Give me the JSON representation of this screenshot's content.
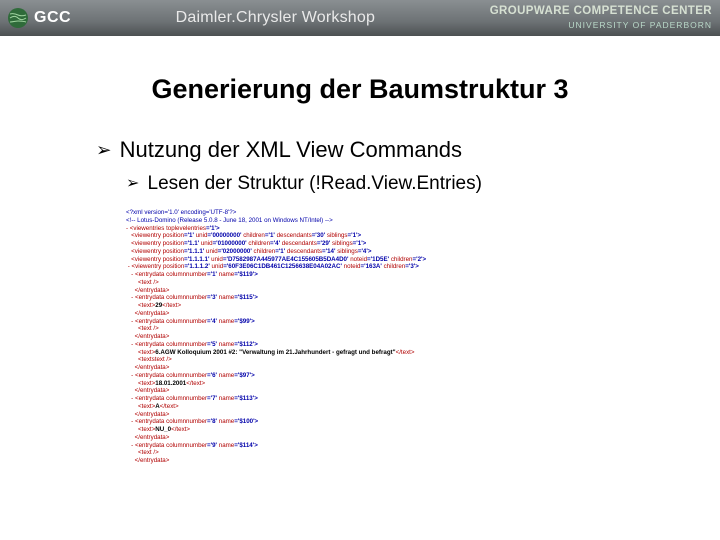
{
  "header": {
    "logo_text": "GCC",
    "title": "Daimler.Chrysler Workshop",
    "org_line1": "GROUPWARE COMPETENCE CENTER",
    "org_line2": "UNIVERSITY OF PADERBORN"
  },
  "slide": {
    "title": "Generierung der Baumstruktur 3"
  },
  "bullets": {
    "b1": "Nutzung der XML View Commands",
    "b2": "Lesen der Struktur (!Read.View.Entries)"
  },
  "xml": {
    "l01": "<?xml version='1.0' encoding='UTF-8'?>",
    "l02": "<!-- Lotus-Domino (Release 5.0.8 - June 18, 2001 on Windows NT/Intel) -->",
    "l03_a_open": "<viewentries ",
    "l03_a_attr": "toplevelentries",
    "l03_a_val": "='1'>",
    "l04_open": "<viewentry ",
    "l04_pos": "position",
    "l04_posv": "='1' ",
    "l04_uid": "unid",
    "l04_uidv": "='00000000' ",
    "l04_ch": "children",
    "l04_chv": "='1' ",
    "l04_de": "descendants",
    "l04_dev": "='30' ",
    "l04_sib": "siblings",
    "l04_sibv": "='1'>",
    "l05_open": "<viewentry ",
    "l05_pos": "position",
    "l05_posv": "='1.1' ",
    "l05_uid": "unid",
    "l05_uidv": "='01000000' ",
    "l05_ch": "children",
    "l05_chv": "='4' ",
    "l05_de": "descendants",
    "l05_dev": "='29' ",
    "l05_sib": "siblings",
    "l05_sibv": "='1'>",
    "l06_open": "<viewentry ",
    "l06_pos": "position",
    "l06_posv": "='1.1.1' ",
    "l06_uid": "unid",
    "l06_uidv": "='02000000' ",
    "l06_ch": "children",
    "l06_chv": "='1' ",
    "l06_de": "descendants",
    "l06_dev": "='14' ",
    "l06_sib": "siblings",
    "l06_sibv": "='4'>",
    "l07_open": "<viewentry ",
    "l07_pos": "position",
    "l07_posv": "='1.1.1.1' ",
    "l07_uid": "unid",
    "l07_uidv": "='D7582987A445977AE4C155605B5DA4D0' ",
    "l07_note": "noteid",
    "l07_notev": "='1D5E' ",
    "l07_ch": "children",
    "l07_chv": "='2'>",
    "l08_open": "<viewentry ",
    "l08_pos": "position",
    "l08_posv": "='1.1.1.2' ",
    "l08_uid": "unid",
    "l08_uidv": "='60F3E06C1DB461C1256638E04A02AC' ",
    "l08_note": "noteid",
    "l08_notev": "='163A' ",
    "l08_ch": "children",
    "l08_chv": "='3'>",
    "l09_open": "<entrydata ",
    "l09_cn": "columnnumber",
    "l09_cnv": "='1' ",
    "l09_nm": "name",
    "l09_nmv": "='$119'>",
    "l10_text_open": "<text />",
    "l11_close_ed": "</entrydata>",
    "l12_open": "<entrydata ",
    "l12_cn": "columnnumber",
    "l12_cnv": "='3' ",
    "l12_nm": "name",
    "l12_nmv": "='$115'>",
    "l13_text_open": "<text>",
    "l13_txt": "29",
    "l13_text_close": "</text>",
    "l14_close_ed": "</entrydata>",
    "l15_open": "<entrydata ",
    "l15_cn": "columnnumber",
    "l15_cnv": "='4' ",
    "l15_nm": "name",
    "l15_nmv": "='$99'>",
    "l16_text_open": "<text />",
    "l17_close_ed": "</entrydata>",
    "l18_open": "<entrydata ",
    "l18_cn": "columnnumber",
    "l18_cnv": "='5' ",
    "l18_nm": "name",
    "l18_nmv": "='$112'>",
    "l19_text_open": "<text>",
    "l19_txt": "6.AGW Kolloquium 2001 #2: \"Verwaltung im 21.Jahrhundert - gefragt und befragt\"",
    "l19_text_close": "</text>",
    "l20_text_open2": "<textstext />",
    "l21_close_ed": "</entrydata>",
    "l22_open": "<entrydata ",
    "l22_cn": "columnnumber",
    "l22_cnv": "='6' ",
    "l22_nm": "name",
    "l22_nmv": "='$97'>",
    "l23_text_open": "<text>",
    "l23_txt": "18.01.2001",
    "l23_text_close": "</text>",
    "l24_close_ed": "</entrydata>",
    "l25_open": "<entrydata ",
    "l25_cn": "columnnumber",
    "l25_cnv": "='7' ",
    "l25_nm": "name",
    "l25_nmv": "='$113'>",
    "l26_text_open": "<text>",
    "l26_txt": "A",
    "l26_text_close": "</text>",
    "l27_close_ed": "</entrydata>",
    "l28_open": "<entrydata ",
    "l28_cn": "columnnumber",
    "l28_cnv": "='8' ",
    "l28_nm": "name",
    "l28_nmv": "='$100'>",
    "l29_text_open": "<text>",
    "l29_txt": "NU_0",
    "l29_text_close": "</text>",
    "l30_close_ed": "</entrydata>",
    "l31_open": "<entrydata ",
    "l31_cn": "columnnumber",
    "l31_cnv": "='9' ",
    "l31_nm": "name",
    "l31_nmv": "='$114'>",
    "l32_text_open": "<text />",
    "l33_close_ed": "</entrydata>"
  }
}
